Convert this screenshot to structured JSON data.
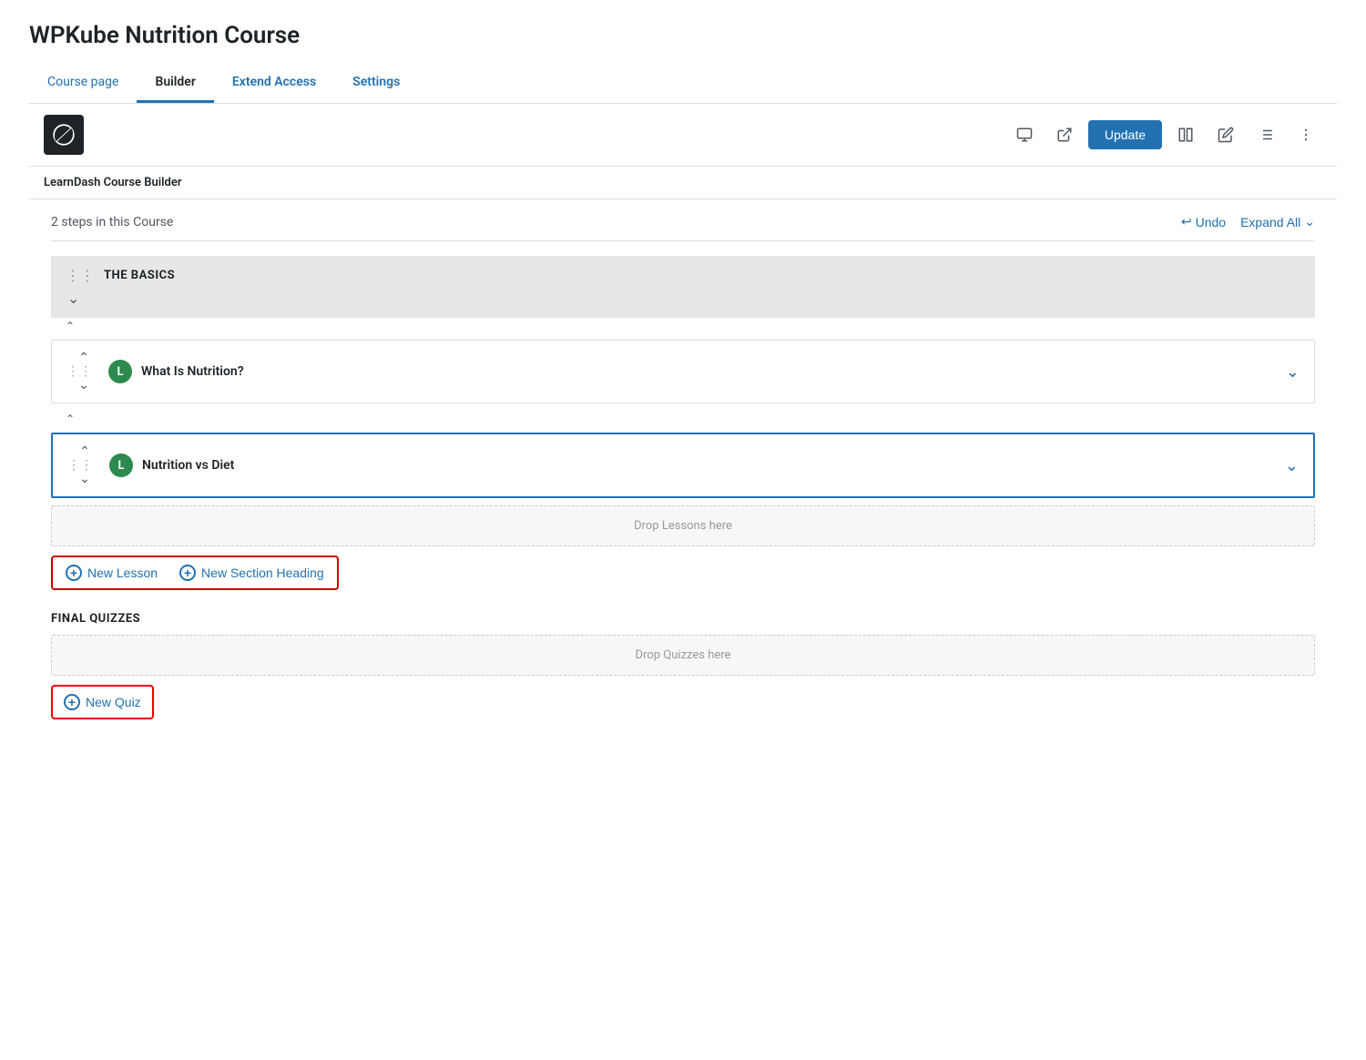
{
  "page": {
    "title": "WPKube Nutrition Course"
  },
  "tabs": [
    {
      "id": "course-page",
      "label": "Course page",
      "active": false
    },
    {
      "id": "builder",
      "label": "Builder",
      "active": true
    },
    {
      "id": "extend-access",
      "label": "Extend Access",
      "active": false
    },
    {
      "id": "settings",
      "label": "Settings",
      "active": false
    }
  ],
  "toolbar": {
    "update_label": "Update",
    "icons": [
      "desktop",
      "external-link",
      "columns",
      "edit",
      "lines",
      "more"
    ]
  },
  "builder_label": "LearnDash Course Builder",
  "steps_header": {
    "count_label": "2 steps in this Course",
    "undo_label": "Undo",
    "expand_all_label": "Expand All"
  },
  "sections": [
    {
      "id": "the-basics",
      "title": "THE BASICS",
      "lessons": [
        {
          "id": "what-is-nutrition",
          "badge": "L",
          "title": "What Is Nutrition?",
          "active": false
        },
        {
          "id": "nutrition-vs-diet",
          "badge": "L",
          "title": "Nutrition vs Diet",
          "active": true
        }
      ]
    }
  ],
  "drop_lessons_label": "Drop Lessons here",
  "add_buttons": {
    "new_lesson_label": "New Lesson",
    "new_section_heading_label": "New Section Heading"
  },
  "final_quizzes": {
    "title": "FINAL QUIZZES",
    "drop_label": "Drop Quizzes here",
    "new_quiz_label": "New Quiz"
  }
}
